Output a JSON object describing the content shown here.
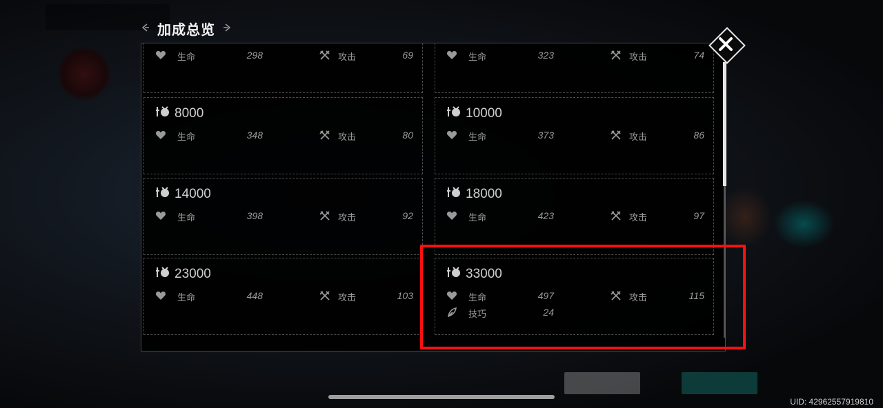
{
  "panel": {
    "title": "加成总览",
    "close_icon": "close-x-icon"
  },
  "cards": [
    {
      "threshold": "",
      "stats": [
        {
          "label": "生命",
          "value": "298"
        },
        {
          "label": "攻击",
          "value": "69"
        }
      ]
    },
    {
      "threshold": "",
      "stats": [
        {
          "label": "生命",
          "value": "323"
        },
        {
          "label": "攻击",
          "value": "74"
        }
      ]
    },
    {
      "threshold": "8000",
      "stats": [
        {
          "label": "生命",
          "value": "348"
        },
        {
          "label": "攻击",
          "value": "80"
        }
      ]
    },
    {
      "threshold": "10000",
      "stats": [
        {
          "label": "生命",
          "value": "373"
        },
        {
          "label": "攻击",
          "value": "86"
        }
      ]
    },
    {
      "threshold": "14000",
      "stats": [
        {
          "label": "生命",
          "value": "398"
        },
        {
          "label": "攻击",
          "value": "92"
        }
      ]
    },
    {
      "threshold": "18000",
      "stats": [
        {
          "label": "生命",
          "value": "423"
        },
        {
          "label": "攻击",
          "value": "97"
        }
      ]
    },
    {
      "threshold": "23000",
      "stats": [
        {
          "label": "生命",
          "value": "448"
        },
        {
          "label": "攻击",
          "value": "103"
        }
      ]
    },
    {
      "threshold": "33000",
      "stats": [
        {
          "label": "生命",
          "value": "497"
        },
        {
          "label": "攻击",
          "value": "115"
        }
      ],
      "extra": {
        "label": "技巧",
        "value": "24"
      }
    }
  ],
  "footer": {
    "uid": "UID: 42962557919810"
  },
  "colors": {
    "highlight": "#ff1010",
    "panel_bg": "#000000",
    "text": "#9a9a9a"
  }
}
